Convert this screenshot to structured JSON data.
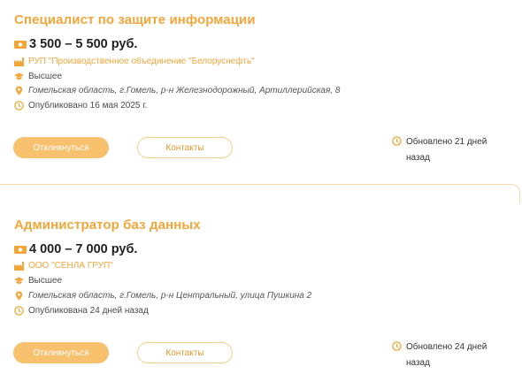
{
  "colors": {
    "accent": "#f2a63a",
    "button_fill": "#f7c16e",
    "border": "#f1cf94"
  },
  "vacancies": [
    {
      "title": "Специалист по защите информации",
      "salary": "3 500 – 5 500 руб.",
      "employer": "РУП \"Производственное объединение \"Белоруснефть\"",
      "education": "Высшее",
      "address": "Гомельская область, г.Гомель, р-н Железнодорожный, Артиллерийская, 8",
      "published": "Опубликовано 16 мая 2025 г.",
      "apply_label": "Откликнуться",
      "contacts_label": "Контакты",
      "updated_line1": "Обновлено 21 дней",
      "updated_line2": "назад"
    },
    {
      "title": "Администратор баз данных",
      "salary": "4 000 – 7 000 руб.",
      "employer": "ООО \"СЕНЛА ГРУП\"",
      "education": "Высшее",
      "address": "Гомельская область, г.Гомель, р-н Центральный, улица Пушкина 2",
      "published": "Опубликована 24 дней назад",
      "apply_label": "Откликнуться",
      "contacts_label": "Контакты",
      "updated_line1": "Обновлено 24 дней",
      "updated_line2": "назад"
    }
  ]
}
